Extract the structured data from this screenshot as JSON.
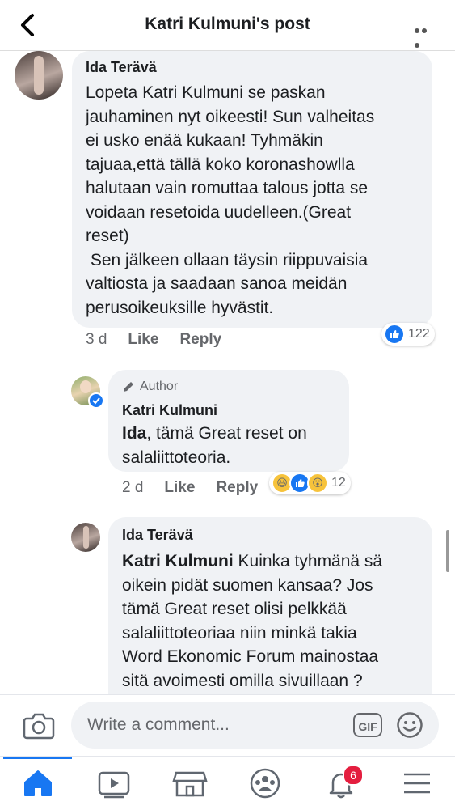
{
  "header": {
    "title": "Katri Kulmuni's post"
  },
  "comments": [
    {
      "author": "Ida Terävä",
      "text": "Lopeta Katri Kulmuni se paskan\njauhaminen nyt oikeesti! Sun valheitas\nei usko enää kukaan! Tyhmäkin\ntajuaa,että tällä koko koronashowlla\nhalutaan vain romuttaa talous jotta se\nvoidaan resetoida uudelleen.(Great\nreset)\n Sen jälkeen ollaan täysin riippuvaisia\nvaltiosta ja saadaan sanoa meidän\nperusoikeuksille hyvästit.",
      "time": "3 d",
      "like": "Like",
      "reply": "Reply",
      "reactions": "122"
    },
    {
      "author_badge": "Author",
      "author": "Katri Kulmuni",
      "mention": "Ida",
      "text": ", tämä Great reset on\nsalaliittoteoria.",
      "time": "2 d",
      "like": "Like",
      "reply": "Reply",
      "reactions": "12"
    },
    {
      "author": "Ida Terävä",
      "mention": "Katri Kulmuni",
      "text": " Kuinka tyhmänä sä\noikein pidät suomen kansaa? Jos\ntämä Great reset olisi pelkkää\nsalaliittoteoriaa niin minkä takia\nWord Ekonomic Forum mainostaa\nsitä avoimesti omilla sivuillaan ?"
    }
  ],
  "composer": {
    "placeholder": "Write a comment...",
    "gif": "GIF"
  },
  "tabbar": {
    "notifications_badge": "6"
  },
  "colors": {
    "accent": "#1877f2",
    "bubble": "#f0f2f5",
    "badge": "#e41e3f"
  }
}
